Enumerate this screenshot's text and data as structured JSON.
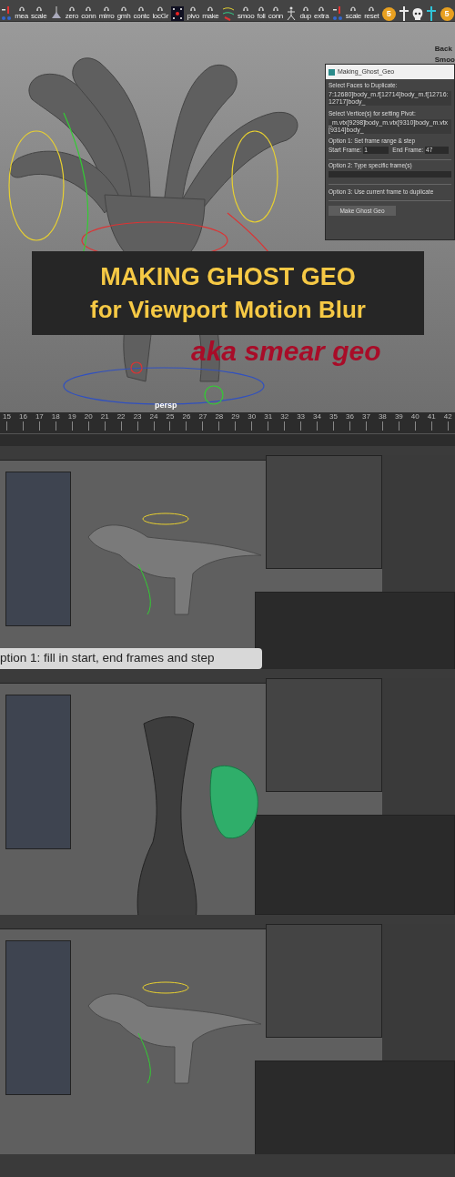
{
  "shelf": [
    {
      "kind": "figure"
    },
    {
      "kind": "tool",
      "label": "mea"
    },
    {
      "kind": "tool",
      "label": "scale"
    },
    {
      "kind": "lamp"
    },
    {
      "kind": "tool",
      "label": "zero"
    },
    {
      "kind": "tool",
      "label": "conn"
    },
    {
      "kind": "tool",
      "label": "mirro"
    },
    {
      "kind": "tool",
      "label": "gmh"
    },
    {
      "kind": "tool",
      "label": "contc"
    },
    {
      "kind": "tool",
      "label": "locGr"
    },
    {
      "kind": "dice"
    },
    {
      "kind": "tool",
      "label": "pivo"
    },
    {
      "kind": "tool",
      "label": "make"
    },
    {
      "kind": "curves"
    },
    {
      "kind": "tool",
      "label": "smoo"
    },
    {
      "kind": "tool",
      "label": "foli"
    },
    {
      "kind": "tool",
      "label": "conn"
    },
    {
      "kind": "skeleton"
    },
    {
      "kind": "tool",
      "label": "dup"
    },
    {
      "kind": "tool",
      "label": "extra"
    },
    {
      "kind": "figure"
    },
    {
      "kind": "tool",
      "label": "scale"
    },
    {
      "kind": "tool",
      "label": "reset"
    },
    {
      "kind": "coin",
      "label": "5"
    },
    {
      "kind": "cross",
      "color": "#e8e8e8"
    },
    {
      "kind": "skull"
    },
    {
      "kind": "cross",
      "color": "#2fc4d8"
    },
    {
      "kind": "coin",
      "label": "5"
    }
  ],
  "viewport": {
    "camera_label": "persp",
    "side_labels": [
      "Back",
      "Smoo"
    ]
  },
  "ghost_dialog": {
    "title": "Making_Ghost_Geo",
    "faces_label": "Select Faces to Duplicate:",
    "faces_value": "7:12680]body_m.f[12714]body_m.f[12716:12717]body_",
    "pivot_label": "Select Vertice(s) for setting Pivot:",
    "pivot_value": "_m.vtx[9298]body_m.vtx[9310]body_m.vtx[9314]body_",
    "option_1": "Option 1: Set frame range & step",
    "start_label": "Start Frame:",
    "start_value": "1",
    "end_label": "End Frame:",
    "end_value": "47",
    "option_2": "Option 2: Type specific frame(s)",
    "option_3": "Option 3: Use current frame to duplicate",
    "button": "Make Ghost Geo"
  },
  "banner": {
    "line_1": "MAKING GHOST GEO",
    "line_2": "for Viewport Motion Blur",
    "subtitle": "aka smear geo"
  },
  "timeline": {
    "ticks": [
      "15",
      "16",
      "17",
      "18",
      "19",
      "20",
      "21",
      "22",
      "23",
      "24",
      "25",
      "26",
      "27",
      "28",
      "29",
      "30",
      "31",
      "32",
      "33",
      "34",
      "35",
      "36",
      "37",
      "38",
      "39",
      "40",
      "41",
      "42"
    ]
  },
  "screenshots": [
    {
      "kind": "dino",
      "caption": "ption 1: fill in start, end frames and step"
    },
    {
      "kind": "vase"
    },
    {
      "kind": "dino"
    }
  ]
}
